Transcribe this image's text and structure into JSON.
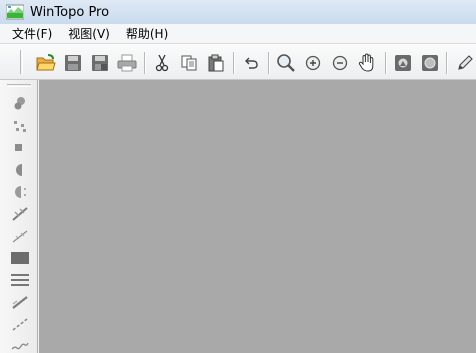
{
  "window": {
    "title": "WinTopo Pro",
    "icon": "wintopo-app-icon"
  },
  "menu": [
    {
      "label": "文件(F)"
    },
    {
      "label": "视图(V)"
    },
    {
      "label": "帮助(H)"
    }
  ],
  "toolbar": {
    "buttons": [
      {
        "icon": "open-folder-icon"
      },
      {
        "icon": "save-icon"
      },
      {
        "icon": "save-as-icon"
      },
      {
        "icon": "print-icon"
      },
      {
        "icon": "cut-icon"
      },
      {
        "icon": "copy-icon"
      },
      {
        "icon": "paste-icon"
      },
      {
        "icon": "undo-icon"
      },
      {
        "icon": "zoom-icon"
      },
      {
        "icon": "zoom-in-icon"
      },
      {
        "icon": "zoom-out-icon"
      },
      {
        "icon": "pan-hand-icon"
      },
      {
        "icon": "vectorize-icon"
      },
      {
        "icon": "raster-icon"
      },
      {
        "icon": "pencil-icon"
      }
    ]
  },
  "left_toolbar": {
    "buttons": [
      {
        "icon": "blob-tool-icon"
      },
      {
        "icon": "dots-tool-icon"
      },
      {
        "icon": "small-square-tool-icon"
      },
      {
        "icon": "half-circle-tool-icon"
      },
      {
        "icon": "half-circle-dotted-tool-icon"
      },
      {
        "icon": "line-slash-tool-icon"
      },
      {
        "icon": "thin-line-tool-icon"
      },
      {
        "icon": "rectangle-tool-icon"
      },
      {
        "icon": "horizontal-lines-tool-icon"
      },
      {
        "icon": "diagonal-line-tool-icon"
      },
      {
        "icon": "dashed-line-tool-icon"
      },
      {
        "icon": "wavy-line-tool-icon"
      }
    ]
  },
  "colors": {
    "canvas": "#a9a9a9",
    "titlebar": "#d6e3f2"
  }
}
